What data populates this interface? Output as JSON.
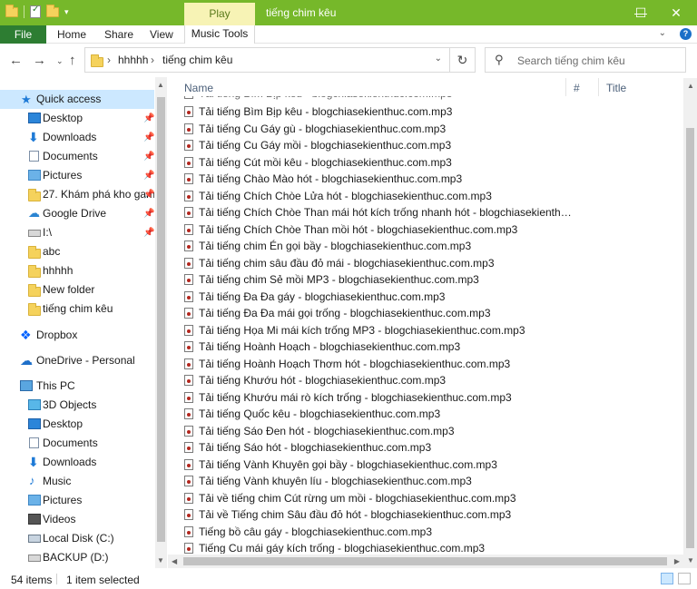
{
  "window": {
    "title": "tiếng chim kêu",
    "play_tab": "Play",
    "minimize": "—",
    "maximize": "☐",
    "close": "✕"
  },
  "ribbon": {
    "file": "File",
    "tabs": [
      "Home",
      "Share",
      "View"
    ],
    "music_tools": "Music Tools"
  },
  "address": {
    "crumbs": [
      "hhhhh",
      "tiếng chim kêu"
    ]
  },
  "search": {
    "placeholder": "Search tiếng chim kêu"
  },
  "columns": {
    "name": "Name",
    "number": "#",
    "title": "Title"
  },
  "nav": {
    "quick_access": "Quick access",
    "items": [
      {
        "label": "Desktop",
        "pinned": true
      },
      {
        "label": "Downloads",
        "pinned": true
      },
      {
        "label": "Documents",
        "pinned": true
      },
      {
        "label": "Pictures",
        "pinned": true
      },
      {
        "label": "27. Khám phá kho gam",
        "pinned": true
      },
      {
        "label": "Google Drive",
        "pinned": true
      },
      {
        "label": "I:\\",
        "pinned": true
      },
      {
        "label": "abc",
        "pinned": false
      },
      {
        "label": "hhhhh",
        "pinned": false
      },
      {
        "label": "New folder",
        "pinned": false
      },
      {
        "label": "tiếng chim kêu",
        "pinned": false
      }
    ],
    "dropbox": "Dropbox",
    "onedrive": "OneDrive - Personal",
    "this_pc": "This PC",
    "pc_items": [
      "3D Objects",
      "Desktop",
      "Documents",
      "Downloads",
      "Music",
      "Pictures",
      "Videos",
      "Local Disk (C:)",
      "BACKUP (D:)"
    ]
  },
  "files": [
    "Tải tiếng Bìm Bịp kêu - blogchiasekienthuc.com.mp3",
    "Tải tiếng Cu Gáy gù - blogchiasekienthuc.com.mp3",
    "Tải tiếng Cu Gáy mồi - blogchiasekienthuc.com.mp3",
    "Tải tiếng Cút mồi kêu - blogchiasekienthuc.com.mp3",
    "Tải tiếng Chào Mào hót - blogchiasekienthuc.com.mp3",
    "Tải tiếng Chích Chòe Lửa hót - blogchiasekienthuc.com.mp3",
    "Tải tiếng Chích Chòe Than mái hót kích trống nhanh hót - blogchiasekienthuc.com....",
    "Tải tiếng Chích Chòe Than mồi hót - blogchiasekienthuc.com.mp3",
    "Tải tiếng chim Én gọi bầy - blogchiasekienthuc.com.mp3",
    "Tải tiếng chim sâu đầu đỏ mái - blogchiasekienthuc.com.mp3",
    "Tải tiếng chim Sẻ mồi MP3 - blogchiasekienthuc.com.mp3",
    "Tải tiếng Đa Đa gáy - blogchiasekienthuc.com.mp3",
    "Tải tiếng Đa Đa mái gọi trống - blogchiasekienthuc.com.mp3",
    "Tải tiếng Họa Mi mái kích trống MP3 - blogchiasekienthuc.com.mp3",
    "Tải tiếng Hoành Hoạch - blogchiasekienthuc.com.mp3",
    "Tải tiếng Hoành Hoạch Thơm hót - blogchiasekienthuc.com.mp3",
    "Tải tiếng Khướu hót - blogchiasekienthuc.com.mp3",
    "Tải tiếng Khướu mái rò kích trống - blogchiasekienthuc.com.mp3",
    "Tải tiếng Quốc kêu - blogchiasekienthuc.com.mp3",
    "Tải tiếng Sáo Đen hót - blogchiasekienthuc.com.mp3",
    "Tải tiếng Sáo hót - blogchiasekienthuc.com.mp3",
    "Tải tiếng Vành Khuyên gọi bầy - blogchiasekienthuc.com.mp3",
    "Tải tiếng Vành khuyên líu - blogchiasekienthuc.com.mp3",
    "Tải về tiếng chim Cút rừng um mồi - blogchiasekienthuc.com.mp3",
    "Tải về Tiếng chim Sâu đầu đỏ hót - blogchiasekienthuc.com.mp3",
    "Tiếng bồ câu gáy - blogchiasekienthuc.com.mp3",
    "Tiếng Cu mái gáy kích trống - blogchiasekienthuc.com.mp3"
  ],
  "status": {
    "count": "54 items",
    "selected": "1 item selected"
  }
}
